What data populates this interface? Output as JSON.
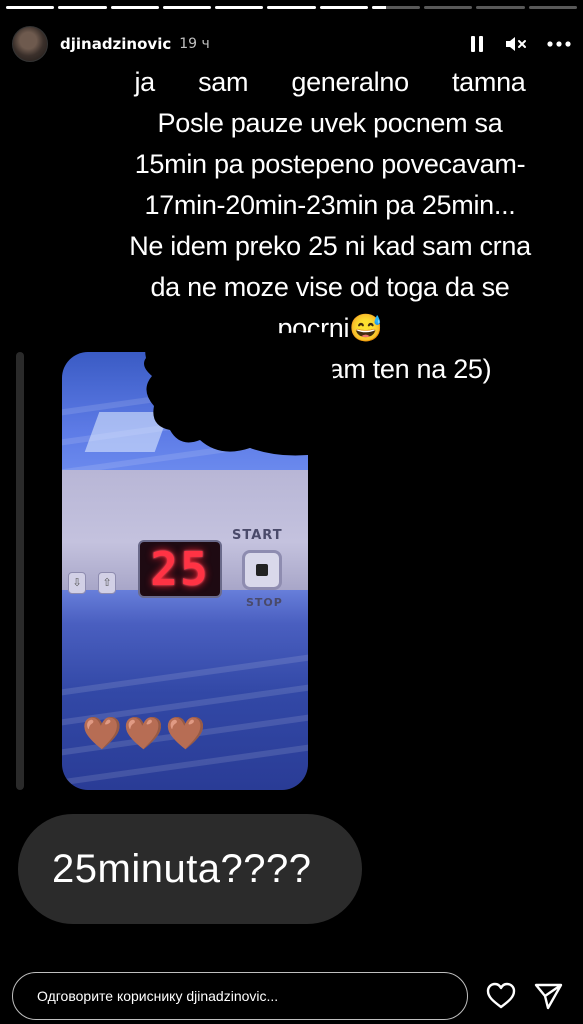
{
  "progress": {
    "segments_total": 11,
    "segments_done": 7,
    "current_fraction": 0.3
  },
  "header": {
    "username": "djinadzinovic",
    "time": "19 ч",
    "icons": [
      "pause-icon",
      "mute-icon",
      "more-icon"
    ]
  },
  "caption": {
    "lines": [
      "ja sam        generalno tamna",
      "Posle pauze uvek pocnem sa",
      "15min pa postepeno povecavam-",
      "17min-20min-23min pa 25min...",
      "Ne idem preko 25 ni kad sam crna",
      "da ne moze vise od toga da se",
      "pocrni😅",
      "(samo odrzavam ten na 25)"
    ]
  },
  "photo": {
    "timer_display": "25",
    "start_label": "START",
    "stop_label": "STOP",
    "hearts": [
      "🤎",
      "🤎",
      "🤎"
    ]
  },
  "message": {
    "text": "25minuta????"
  },
  "reply": {
    "placeholder": "Одговорите кориснику djinadzinovic..."
  },
  "colors": {
    "background": "#000000",
    "bubble": "#2b2b2b",
    "led": "#ff3344"
  }
}
